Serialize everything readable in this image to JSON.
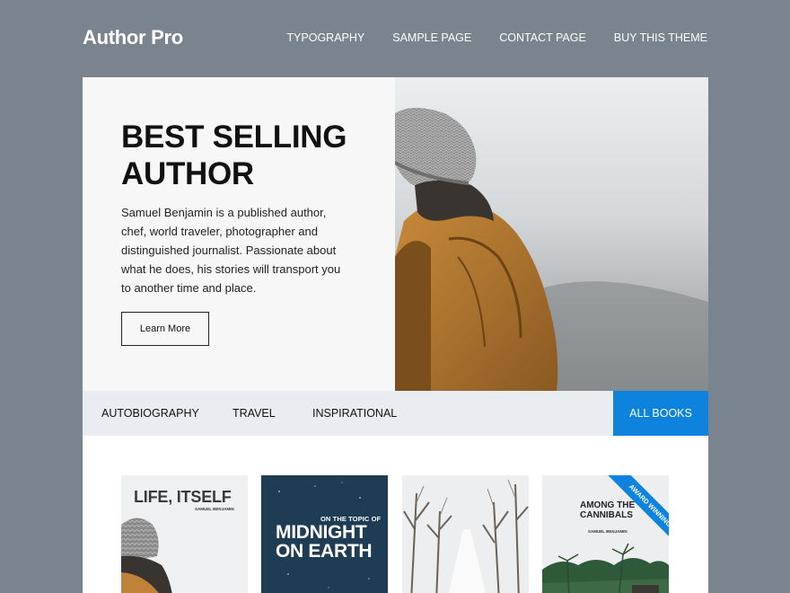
{
  "header": {
    "logo": "Author Pro",
    "nav": [
      "TYPOGRAPHY",
      "SAMPLE PAGE",
      "CONTACT PAGE",
      "BUY THIS THEME"
    ]
  },
  "hero": {
    "title_line1": "BEST SELLING",
    "title_line2": "AUTHOR",
    "description": "Samuel Benjamin is a published author, chef, world traveler, photographer and distinguished journalist. Passionate about what he does, his stories will transport you to another time and place.",
    "button": "Learn More"
  },
  "tabs": {
    "items": [
      "AUTOBIOGRAPHY",
      "TRAVEL",
      "INSPIRATIONAL"
    ],
    "all": "ALL BOOKS"
  },
  "books": [
    {
      "title": "LIFE, ITSELF",
      "author": "SAMUEL BENJAMIN"
    },
    {
      "subtitle": "ON THE TOPIC OF",
      "title_line1": "MIDNIGHT",
      "title_line2": "ON EARTH"
    },
    {},
    {
      "title_line1": "AMONG THE",
      "title_line2": "CANNIBALS",
      "author": "SAMUEL BENJAMIN",
      "ribbon": "AWARD WINNING"
    }
  ],
  "colors": {
    "page_bg": "#79848e",
    "accent": "#0d83dd",
    "tabs_bg": "#e9edf1"
  }
}
